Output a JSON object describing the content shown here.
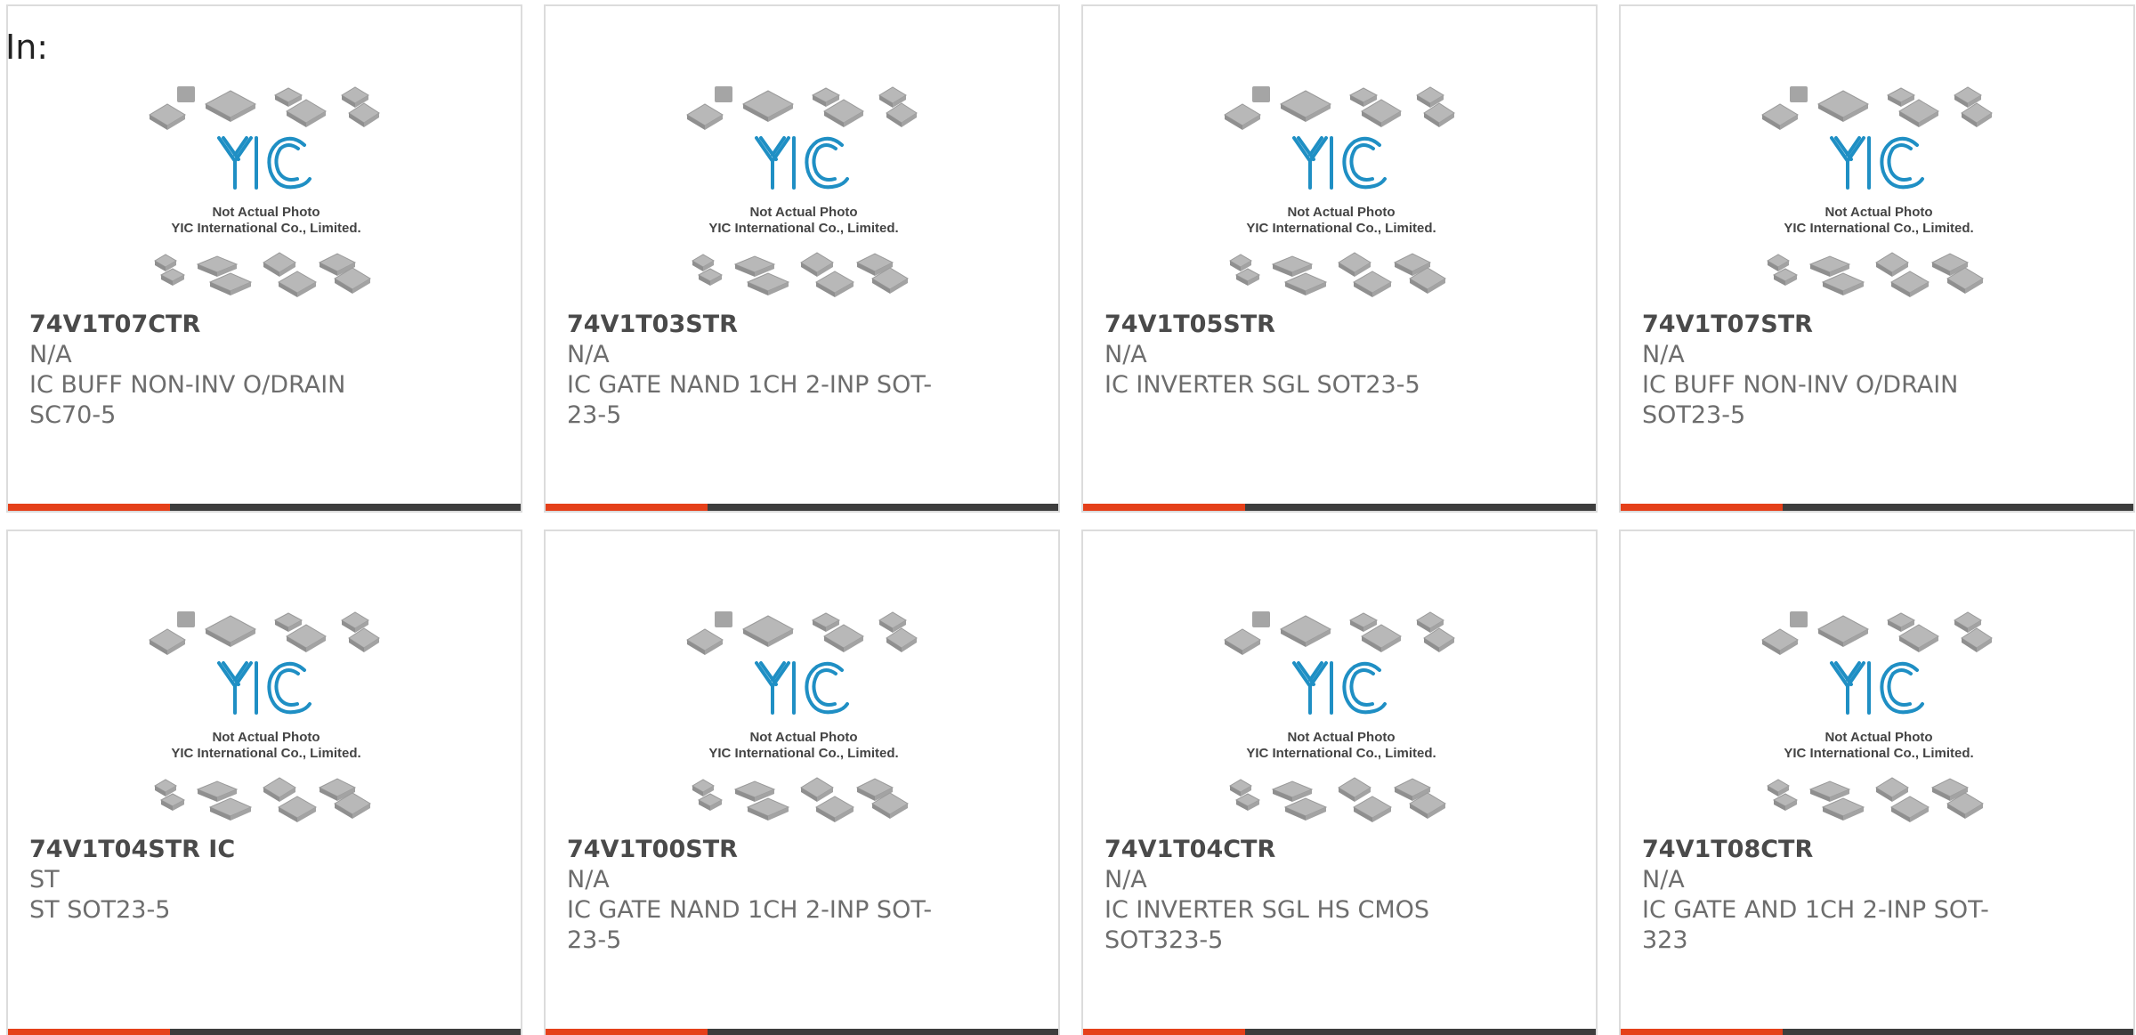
{
  "header": {
    "label": "In:"
  },
  "image": {
    "caption_line1": "Not Actual Photo",
    "caption_line2": "YIC International Co., Limited."
  },
  "colors": {
    "accent": "#e5401a",
    "bar": "#3d3d3d",
    "logo": "#1f8fc4",
    "border": "#dcdcdc"
  },
  "products": [
    {
      "part_number": "74V1T07CTR",
      "manufacturer": "N/A",
      "description": "IC BUFF NON-INV O/DRAIN SC70-5"
    },
    {
      "part_number": "74V1T03STR",
      "manufacturer": "N/A",
      "description": "IC GATE NAND 1CH 2-INP SOT-23-5"
    },
    {
      "part_number": "74V1T05STR",
      "manufacturer": "N/A",
      "description": "IC INVERTER SGL SOT23-5"
    },
    {
      "part_number": "74V1T07STR",
      "manufacturer": "N/A",
      "description": "IC BUFF NON-INV O/DRAIN SOT23-5"
    },
    {
      "part_number": "74V1T04STR IC",
      "manufacturer": "ST",
      "description": "ST SOT23-5"
    },
    {
      "part_number": "74V1T00STR",
      "manufacturer": "N/A",
      "description": "IC GATE NAND 1CH 2-INP SOT-23-5"
    },
    {
      "part_number": "74V1T04CTR",
      "manufacturer": "N/A",
      "description": "IC INVERTER SGL HS CMOS SOT323-5"
    },
    {
      "part_number": "74V1T08CTR",
      "manufacturer": "N/A",
      "description": "IC GATE AND 1CH 2-INP SOT-323"
    }
  ]
}
